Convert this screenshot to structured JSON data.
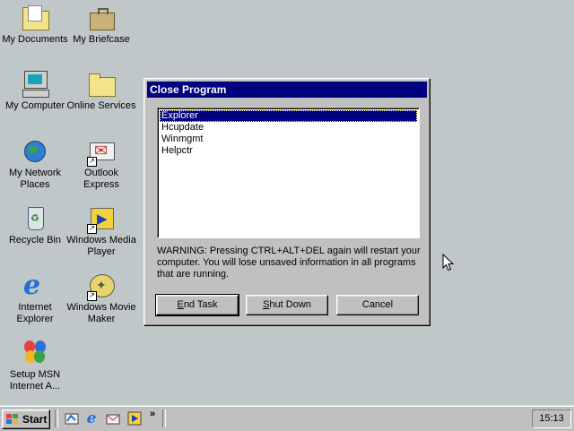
{
  "desktop": {
    "icons": [
      {
        "label": "My Documents"
      },
      {
        "label": "My Briefcase"
      },
      {
        "label": "My Computer"
      },
      {
        "label": "Online Services"
      },
      {
        "label": "My Network Places"
      },
      {
        "label": "Outlook Express"
      },
      {
        "label": "Recycle Bin"
      },
      {
        "label": "Windows Media Player"
      },
      {
        "label": "Internet Explorer"
      },
      {
        "label": "Windows Movie Maker"
      },
      {
        "label": "Setup MSN Internet A..."
      }
    ]
  },
  "dialog": {
    "title": "Close Program",
    "processes": [
      "Explorer",
      "Hcupdate",
      "Winmgmt",
      "Helpctr"
    ],
    "selected_process": "Explorer",
    "warning": "WARNING: Pressing CTRL+ALT+DEL again will restart your computer. You will lose unsaved information in all programs that are running.",
    "buttons": {
      "end_task": {
        "prefix": "",
        "accel": "E",
        "rest": "nd Task"
      },
      "shut_down": {
        "prefix": "",
        "accel": "S",
        "rest": "hut Down"
      },
      "cancel": {
        "label": "Cancel"
      }
    }
  },
  "taskbar": {
    "start_label": "Start",
    "quick_launch": [
      "show-desktop-icon",
      "internet-explorer-icon",
      "outlook-express-icon",
      "media-player-icon"
    ],
    "more_glyph": "»",
    "clock": "15:13"
  },
  "colors": {
    "desktop": "#c0c7c8",
    "title_active": "#000080",
    "selection": "#000080"
  }
}
